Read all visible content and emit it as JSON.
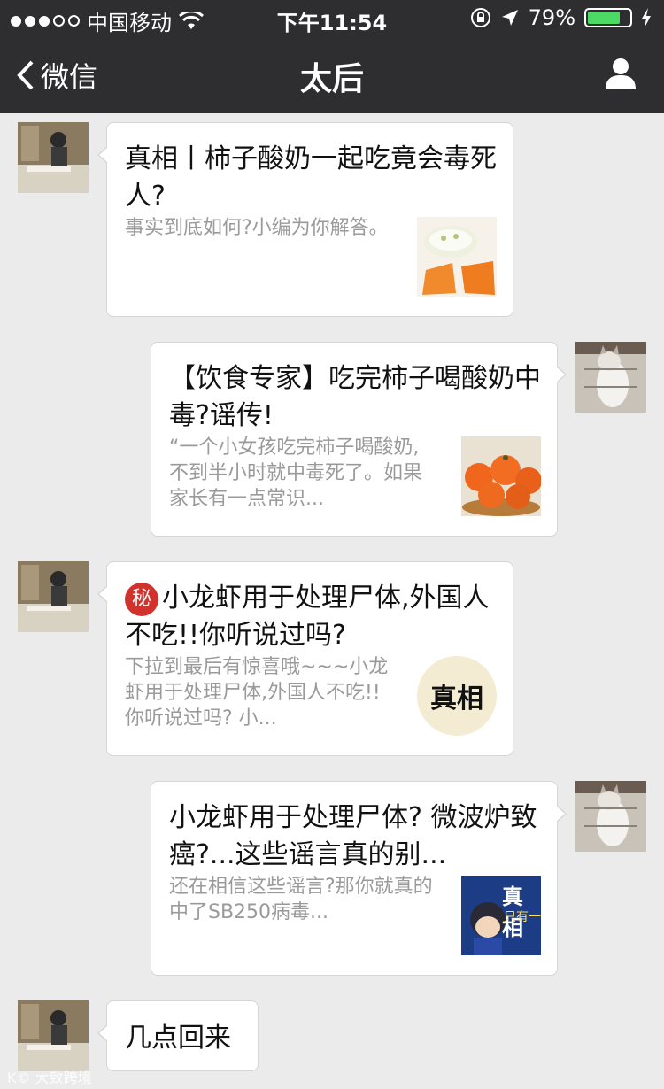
{
  "status_bar": {
    "carrier": "中国移动",
    "time": "下午11:54",
    "battery": "79%",
    "battery_level": 0.79,
    "signal_dots_filled": 3,
    "signal_dots_total": 5
  },
  "nav": {
    "back_label": "微信",
    "title": "太后"
  },
  "messages": [
    {
      "title": "真相丨柿子酸奶一起吃竟会毒死人?",
      "desc": "事实到底如何?小编为你解答。"
    },
    {
      "title": "【饮食专家】吃完柿子喝酸奶中毒?谣传!",
      "desc": "“一个小女孩吃完柿子喝酸奶,不到半小时就中毒死了。如果家长有一点常识..."
    },
    {
      "badge": "秘",
      "title": "小龙虾用于处理尸体,外国人不吃!!你听说过吗?",
      "desc": "下拉到最后有惊喜哦~~~小龙虾用于处理尸体,外国人不吃!!你听说过吗? 小...",
      "thumb_text": "真相"
    },
    {
      "title": "小龙虾用于处理尸体? 微波炉致癌?...这些谣言真的别...",
      "desc": "还在相信这些谣言?那你就真的中了SB250病毒...",
      "thumb_text": "真相",
      "thumb_sub": "只有一"
    },
    {
      "text": "几点回来"
    }
  ],
  "watermark": "K© 大致跨境"
}
